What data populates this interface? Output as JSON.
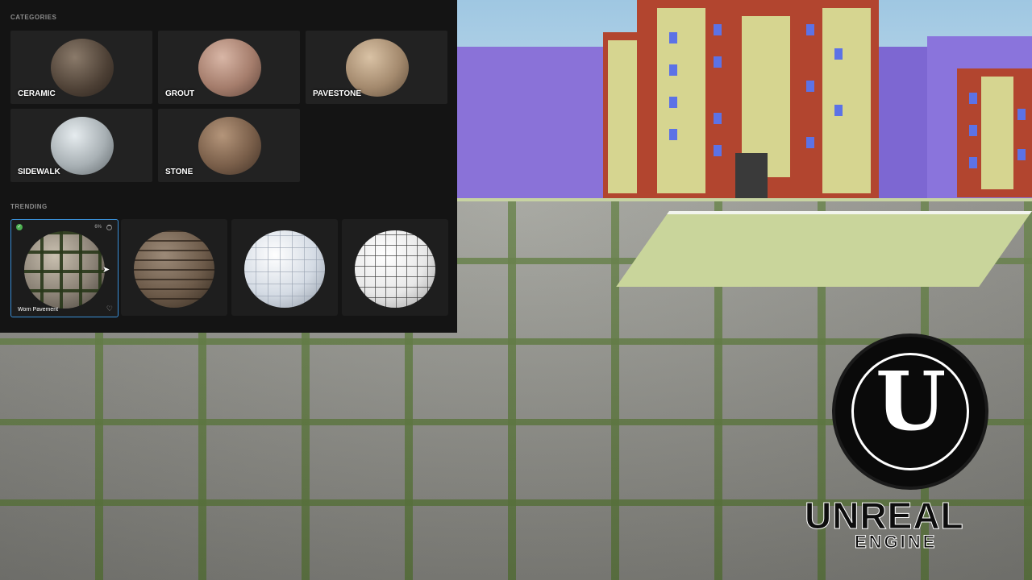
{
  "browser": {
    "categories_heading": "CATEGORIES",
    "categories": [
      {
        "label": "CERAMIC",
        "icon": "ceramic-sphere"
      },
      {
        "label": "GROUT",
        "icon": "grout-sphere"
      },
      {
        "label": "PAVESTONE",
        "icon": "pavestone-sphere"
      },
      {
        "label": "SIDEWALK",
        "icon": "sidewalk-sphere"
      },
      {
        "label": "STONE",
        "icon": "stone-sphere"
      }
    ],
    "trending_heading": "TRENDING",
    "trending": [
      {
        "caption": "Worn Pavement",
        "progress_text": "6%",
        "selected": true
      },
      {
        "caption": "",
        "selected": false
      },
      {
        "caption": "",
        "selected": false
      },
      {
        "caption": "",
        "selected": false
      }
    ]
  },
  "logo": {
    "word": "UNREAL",
    "sub": "ENGINE"
  },
  "colors": {
    "panel_bg": "#141414",
    "tile_bg": "#222222",
    "selection": "#3a8fd6",
    "check": "#4caf50"
  }
}
